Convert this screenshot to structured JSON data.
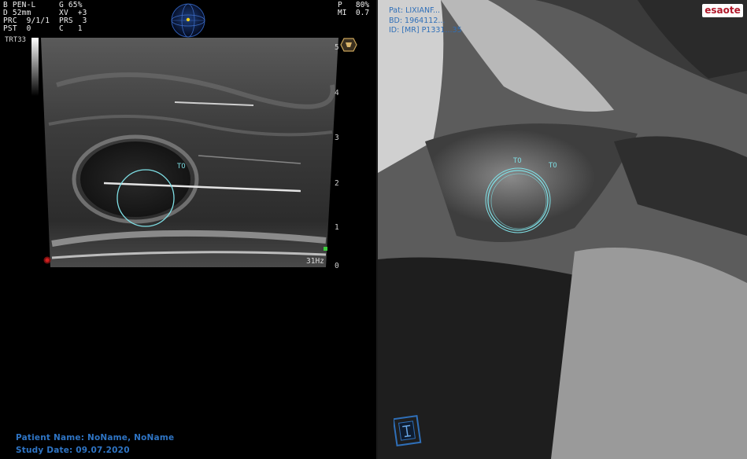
{
  "ultrasound": {
    "params": {
      "line1": "B PEN-L     G 65%",
      "line2": "D 52mm      XV  +3",
      "line3": "PRC  9/1/1  PRS  3",
      "line4": "PST  0      C   1"
    },
    "pmi": {
      "line1": "P   80%",
      "line2": "MI  0.7"
    },
    "grayscale_label": "TRT33",
    "depth_ticks": [
      "5",
      "4",
      "3",
      "2",
      "1",
      "0"
    ],
    "frame_rate": "31Hz",
    "target_label": "T0",
    "patient_name": "Patient Name: NoName, NoName",
    "study_date": "Study Date: 09.07.2020",
    "colors": {
      "target_circle": "#7fe0e6",
      "patient_text": "#2e74c4",
      "marker": "#3ccc3c"
    }
  },
  "mri": {
    "patient": "Pat: LIXIANF...",
    "birth_date": "BD: 1964112...",
    "id": "ID: [MR] P1331...35",
    "target_label_1": "T0",
    "target_label_2": "T0",
    "logo": "esaote",
    "colors": {
      "overlay_text": "#2f6fb8",
      "logo": "#b0182a"
    }
  },
  "icons": {
    "orientation_globe": "orientation-globe-icon",
    "probe": "probe-icon",
    "body_marker": "body-marker-icon",
    "record": "record-dot-icon"
  }
}
